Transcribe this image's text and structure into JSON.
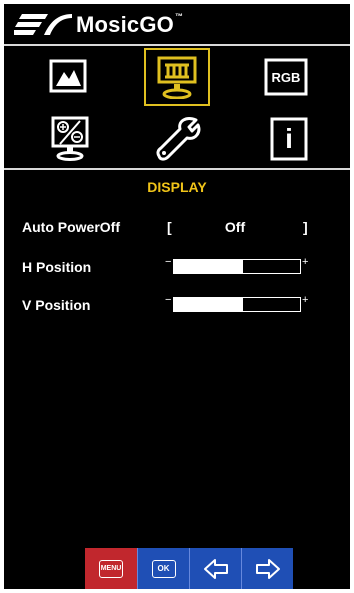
{
  "brand": {
    "name": "MosicGO",
    "tm": "™"
  },
  "menu_icons": [
    {
      "name": "picture-icon"
    },
    {
      "name": "display-icon",
      "selected": true
    },
    {
      "name": "rgb-icon",
      "label": "RGB"
    },
    {
      "name": "color-settings-icon"
    },
    {
      "name": "setup-wrench-icon"
    },
    {
      "name": "info-icon",
      "label": "i"
    }
  ],
  "section": {
    "title": "DISPLAY"
  },
  "auto_power_off": {
    "label": "Auto PowerOff",
    "open": "[",
    "value": "Off",
    "close": "]"
  },
  "h_position": {
    "label": "H Position",
    "minus": "−",
    "plus": "+",
    "level": 0.55
  },
  "v_position": {
    "label": "V Position",
    "minus": "−",
    "plus": "+",
    "level": 0.55
  },
  "buttons": {
    "menu": "MENU",
    "ok": "OK"
  },
  "colors": {
    "accent": "#f0c419",
    "menu_button": "#c1272d",
    "nav_button": "#1f4fb5"
  }
}
